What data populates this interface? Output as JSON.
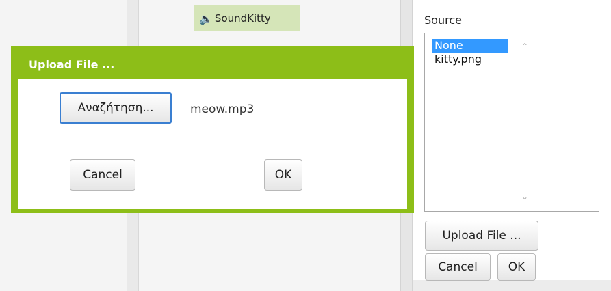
{
  "component": {
    "icon": "speaker-icon",
    "name": "SoundKitty"
  },
  "properties": {
    "source_label": "Source",
    "source_list": [
      {
        "label": "None",
        "selected": true
      },
      {
        "label": "kitty.png",
        "selected": false
      }
    ],
    "upload_button": "Upload File ...",
    "cancel_button": "Cancel",
    "ok_button": "OK"
  },
  "dialog": {
    "title": "Upload File ...",
    "browse_button": "Αναζήτηση...",
    "filename": "meow.mp3",
    "cancel_button": "Cancel",
    "ok_button": "OK"
  },
  "colors": {
    "accent": "#8dbe18",
    "chip": "#d5e5b8",
    "selection": "#3399ff"
  }
}
